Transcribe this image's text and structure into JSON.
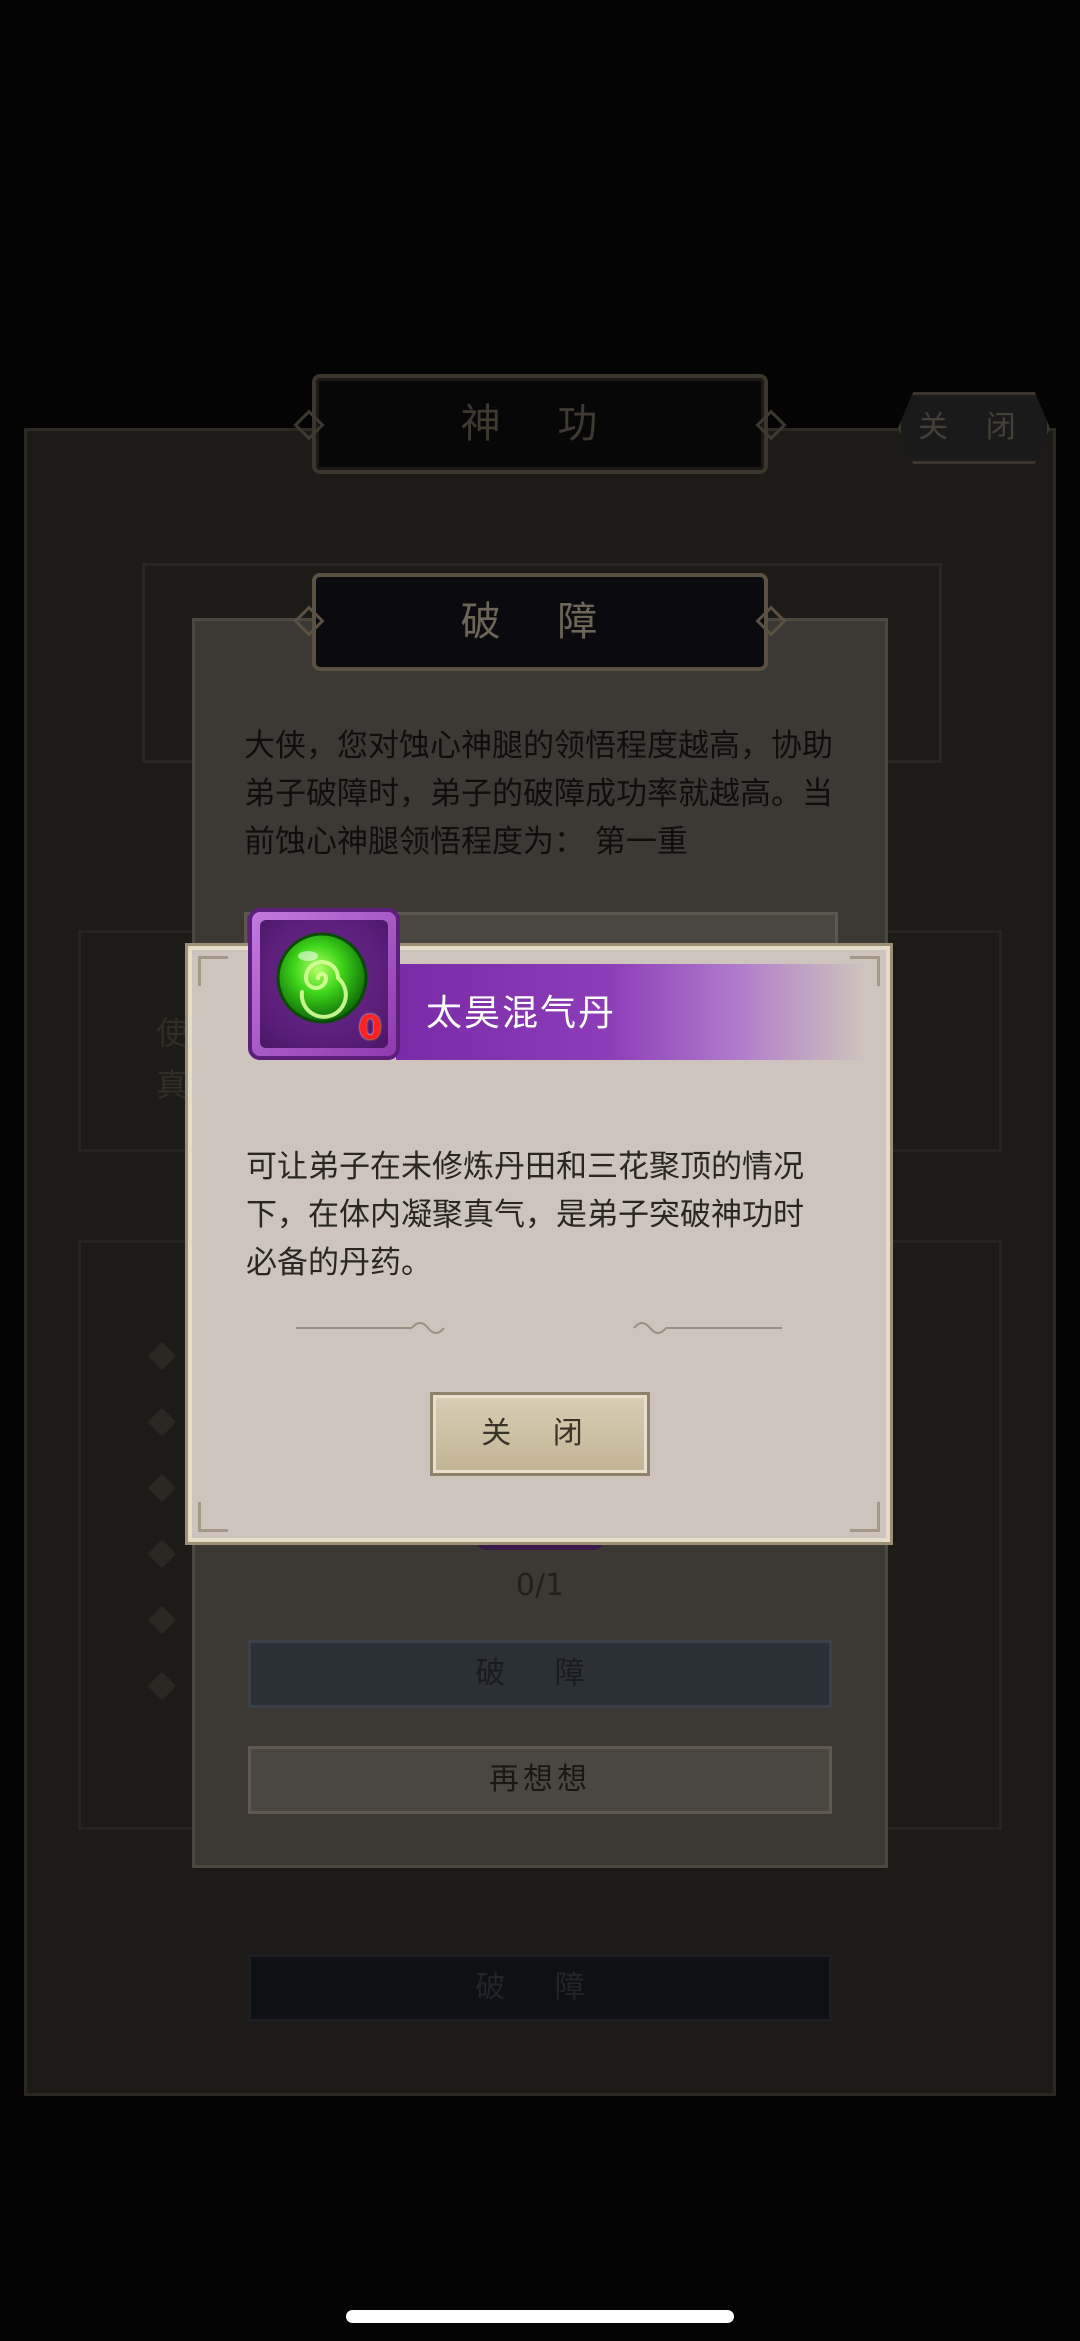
{
  "background_panel": {
    "title": "神 功",
    "close_label": "关 闭",
    "desc_line": "使",
    "desc_line_2": "真",
    "break_label": "破 障"
  },
  "breakthrough_dialog": {
    "title": "破 障",
    "description": [
      "大侠，您对蚀心神腿的领悟程度越高，协助",
      "弟子破障时，弟子的破障成功率就越高。当",
      "前蚀心神腿领悟程度为：  第一重"
    ],
    "progress": "0/1",
    "break_label": "破 障",
    "rethink_label": "再想想"
  },
  "item_popup": {
    "item_name": "太昊混气丹",
    "item_count": "0",
    "description": [
      "可让弟子在未修炼丹田和三花聚顶的情况",
      "下，在体内凝聚真气，是弟子突破神功时",
      "必备的丹药。"
    ],
    "close_label": "关 闭",
    "icon": "green-pill-icon"
  },
  "colors": {
    "item_header": "#8c3db7",
    "popup_bg": "#cdc5bd",
    "count_red": "#ff2020"
  }
}
